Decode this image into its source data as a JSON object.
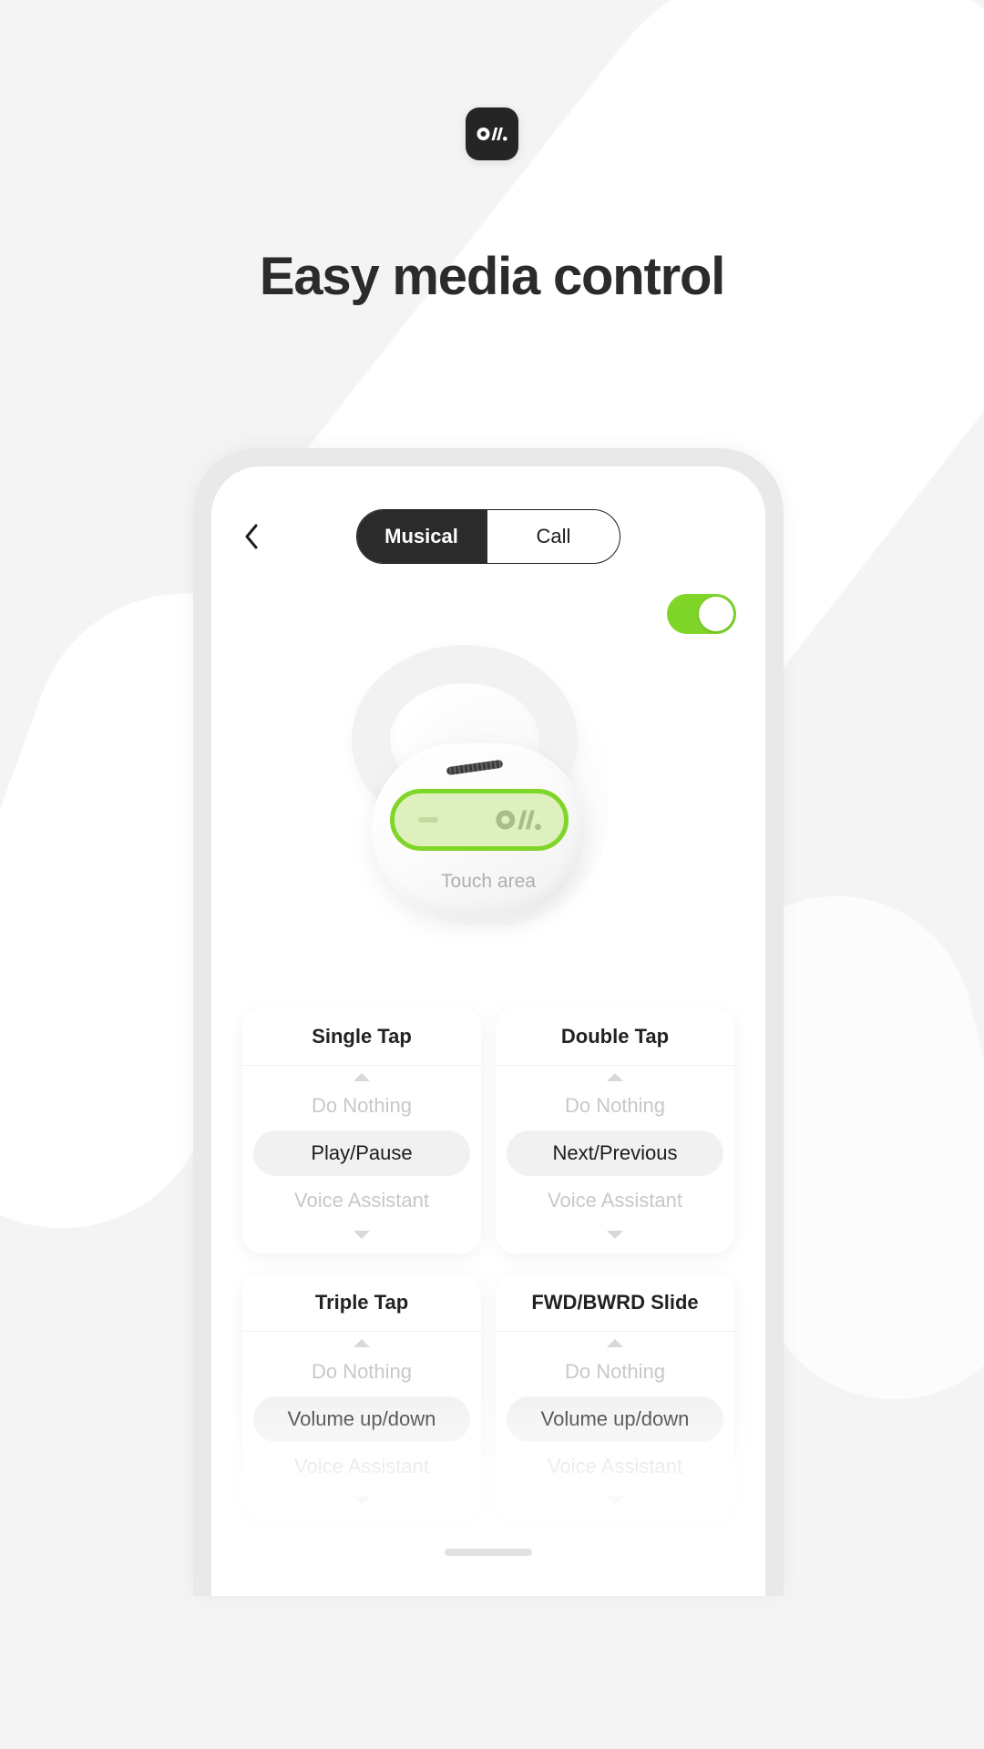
{
  "brand": {
    "logo_icon": "om-logo-icon",
    "logo_text": "O//."
  },
  "headline": "Easy media control",
  "phone": {
    "topbar": {
      "back_icon": "chevron-left-icon",
      "segmented": {
        "options": [
          {
            "label": "Musical",
            "active": true
          },
          {
            "label": "Call",
            "active": false
          }
        ]
      }
    },
    "toggle": {
      "state": "on",
      "accent_color": "#7fd629",
      "knob_color": "#ffffff"
    },
    "earbud": {
      "touch_area_label": "Touch area",
      "touch_area_logo": "O//.",
      "border_color": "#7fd629",
      "fill_color": "#dff0bf",
      "mesh_icon": "speaker-mesh-icon"
    },
    "cards": [
      {
        "title": "Single Tap",
        "up_icon": "chevron-up-icon",
        "down_icon": "chevron-down-icon",
        "options": [
          {
            "label": "Do Nothing",
            "selected": false
          },
          {
            "label": "Play/Pause",
            "selected": true
          },
          {
            "label": "Voice Assistant",
            "selected": false
          }
        ]
      },
      {
        "title": "Double Tap",
        "up_icon": "chevron-up-icon",
        "down_icon": "chevron-down-icon",
        "options": [
          {
            "label": "Do Nothing",
            "selected": false
          },
          {
            "label": "Next/Previous",
            "selected": true
          },
          {
            "label": "Voice Assistant",
            "selected": false
          }
        ]
      },
      {
        "title": "Triple Tap",
        "up_icon": "chevron-up-icon",
        "down_icon": "chevron-down-icon",
        "options": [
          {
            "label": "Do Nothing",
            "selected": false
          },
          {
            "label": "Volume up/down",
            "selected": true
          },
          {
            "label": "Voice Assistant",
            "selected": false
          }
        ]
      },
      {
        "title": "FWD/BWRD  Slide",
        "up_icon": "chevron-up-icon",
        "down_icon": "chevron-down-icon",
        "options": [
          {
            "label": "Do Nothing",
            "selected": false
          },
          {
            "label": "Volume up/down",
            "selected": true
          },
          {
            "label": "Voice Assistant",
            "selected": false
          }
        ]
      }
    ],
    "home_indicator": "home-indicator"
  },
  "colors": {
    "background": "#f4f4f4",
    "blob": "#ffffff",
    "accent_green": "#7fd629",
    "dark": "#2b2b2b",
    "muted_text": "#c8c8c8"
  }
}
